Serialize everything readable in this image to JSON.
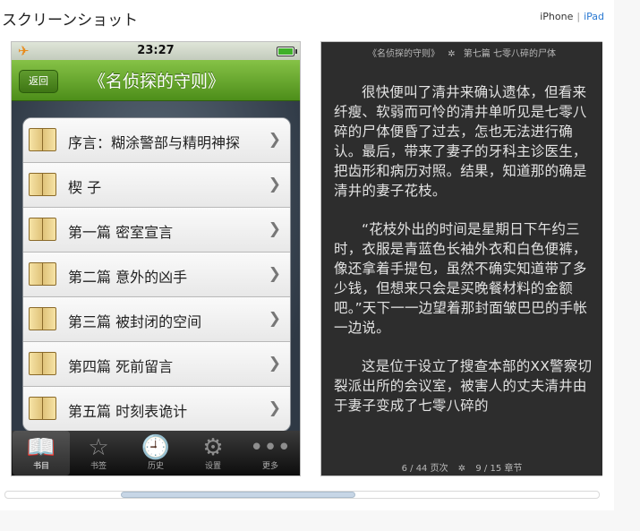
{
  "header": {
    "title": "スクリーンショット",
    "iphone_label": "iPhone",
    "separator": "|",
    "ipad_label": "iPad"
  },
  "phone1": {
    "status": {
      "time": "23:27",
      "plane_icon": "airplane-icon",
      "battery_icon": "battery-icon"
    },
    "nav": {
      "back_label": "返回",
      "title": "《名侦探的守则》"
    },
    "list": [
      {
        "label": "序言：糊涂警部与精明神探"
      },
      {
        "label": "楔 子"
      },
      {
        "label": "第一篇 密室宣言"
      },
      {
        "label": "第二篇 意外的凶手"
      },
      {
        "label": "第三篇 被封闭的空间"
      },
      {
        "label": "第四篇 死前留言"
      },
      {
        "label": "第五篇 时刻表诡计"
      }
    ],
    "tabs": [
      {
        "label": "书目",
        "icon": "book-open-icon",
        "active": true
      },
      {
        "label": "书签",
        "icon": "star-icon"
      },
      {
        "label": "历史",
        "icon": "clock-icon"
      },
      {
        "label": "设置",
        "icon": "gear-icon"
      },
      {
        "label": "更多",
        "icon": "more-icon"
      }
    ]
  },
  "phone2": {
    "header_book": "《名侦探的守则》",
    "header_chapter": "第七篇 七零八碎的尸体",
    "paragraphs": [
      "很快便叫了清井来确认遗体，但看来纤瘦、软弱而可怜的清井单听见是七零八碎的尸体便昏了过去，怎也无法进行确认。最后，带来了妻子的牙科主诊医生，把齿形和病历对照。结果，知道那的确是清井的妻子花枝。",
      "“花枝外出的时间是星期日下午约三时，衣服是青蓝色长袖外衣和白色便裤，像还拿着手提包，虽然不确实知道带了多少钱，但想来只会是买晚餐材料的金额吧。”天下一一边望着那封面皱巴巴的手帐一边说。",
      "这是位于设立了搜查本部的XX警察切裂派出所的会议室，被害人的丈夫清井由于妻子变成了七零八碎的"
    ],
    "footer_pages": "6 / 44 页次",
    "footer_chapters": "9 / 15 章节"
  },
  "scrollbar": {
    "position_fraction": 0.2
  }
}
